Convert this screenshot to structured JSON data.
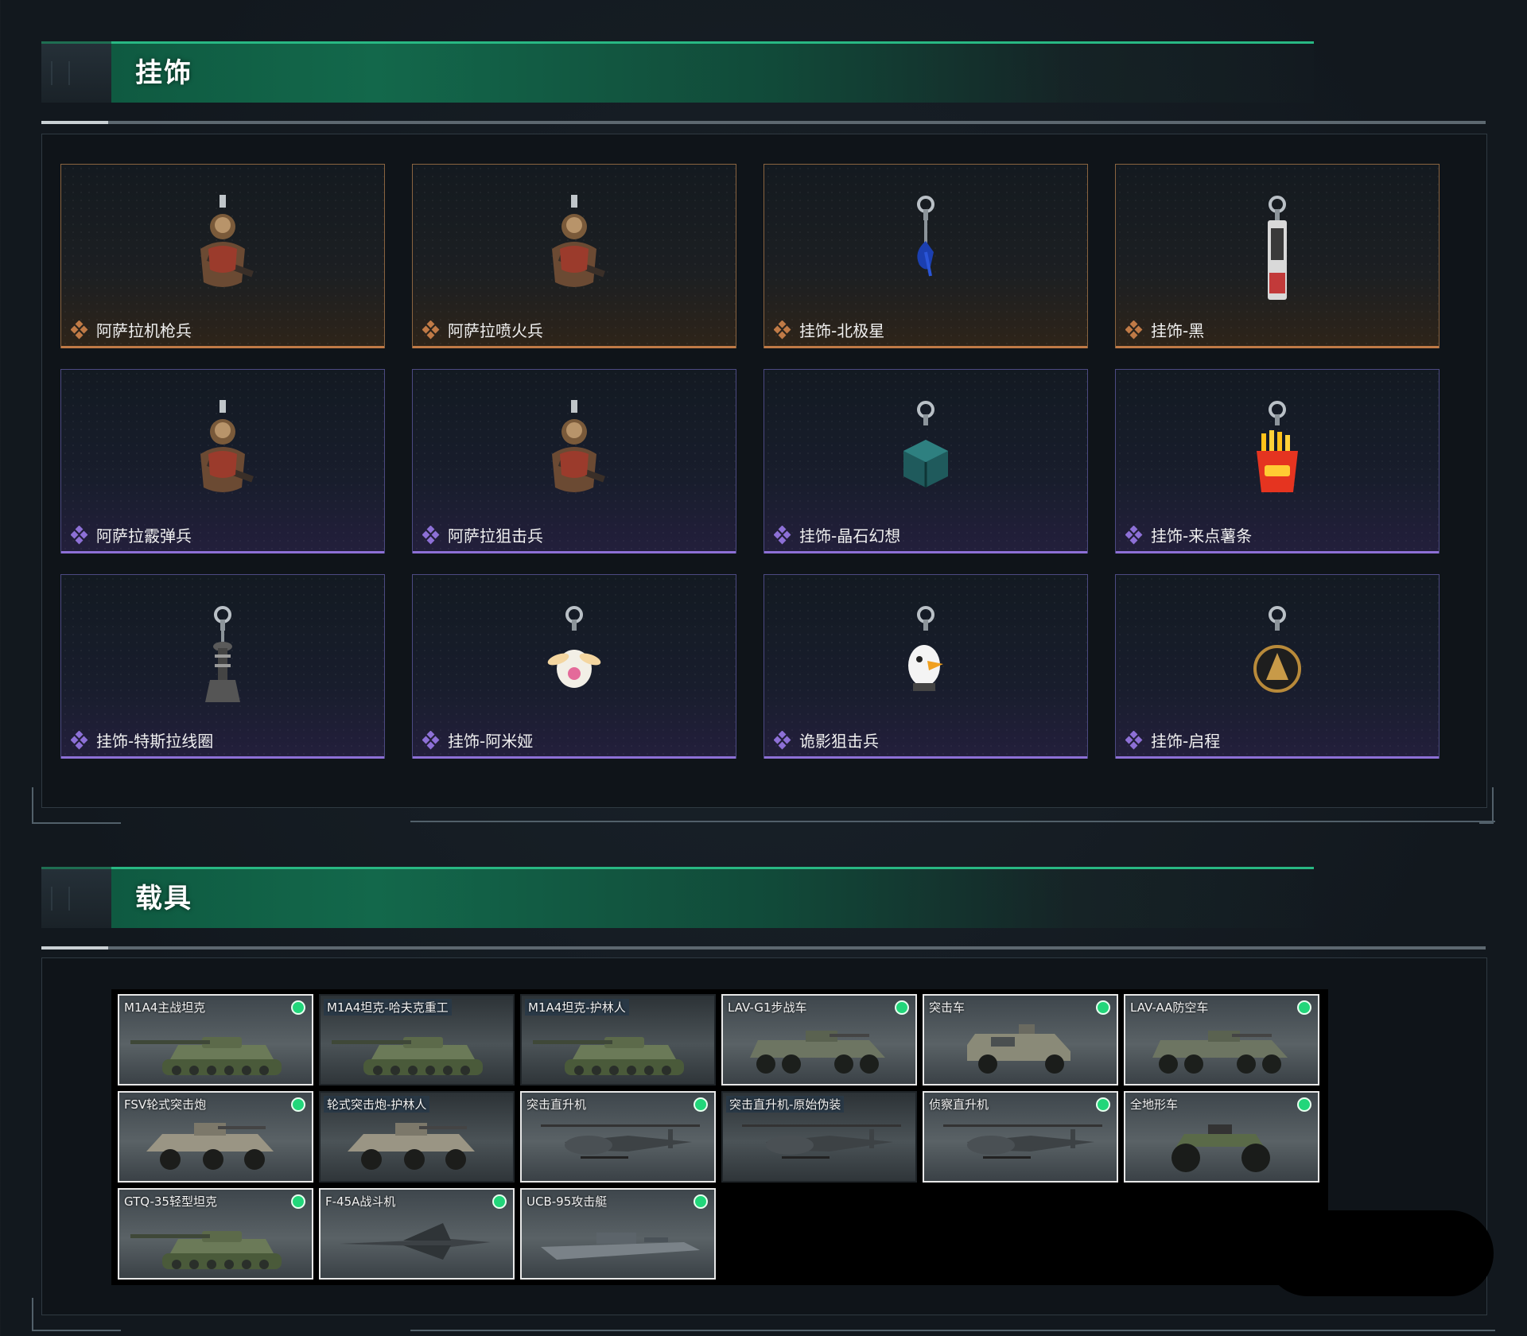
{
  "sections": {
    "charms": {
      "title": "挂饰",
      "items": [
        {
          "name": "阿萨拉机枪兵",
          "rarity": "gold",
          "icon": "operator-figure-icon"
        },
        {
          "name": "阿萨拉喷火兵",
          "rarity": "gold",
          "icon": "operator-figure-icon"
        },
        {
          "name": "挂饰-北极星",
          "rarity": "gold",
          "icon": "star-charm-icon"
        },
        {
          "name": "挂饰-黑",
          "rarity": "gold",
          "icon": "tag-charm-icon"
        },
        {
          "name": "阿萨拉霰弹兵",
          "rarity": "purple",
          "icon": "operator-figure-icon"
        },
        {
          "name": "阿萨拉狙击兵",
          "rarity": "purple",
          "icon": "operator-figure-icon"
        },
        {
          "name": "挂饰-晶石幻想",
          "rarity": "purple",
          "icon": "cube-charm-icon"
        },
        {
          "name": "挂饰-来点薯条",
          "rarity": "purple",
          "icon": "fries-charm-icon"
        },
        {
          "name": "挂饰-特斯拉线圈",
          "rarity": "purple",
          "icon": "tesla-coil-charm-icon"
        },
        {
          "name": "挂饰-阿米娅",
          "rarity": "purple",
          "icon": "bunny-charm-icon"
        },
        {
          "name": "诡影狙击兵",
          "rarity": "purple",
          "icon": "duck-charm-icon"
        },
        {
          "name": "挂饰-启程",
          "rarity": "purple",
          "icon": "medal-charm-icon"
        }
      ]
    },
    "vehicles": {
      "title": "载具",
      "items": [
        {
          "name": "M1A4主战坦克",
          "owned": true,
          "highlight": true,
          "kind": "tank"
        },
        {
          "name": "M1A4坦克-哈夫克重工",
          "owned": false,
          "highlight": false,
          "kind": "tank"
        },
        {
          "name": "M1A4坦克-护林人",
          "owned": false,
          "highlight": false,
          "kind": "tank"
        },
        {
          "name": "LAV-G1步战车",
          "owned": true,
          "highlight": true,
          "kind": "apc"
        },
        {
          "name": "突击车",
          "owned": true,
          "highlight": true,
          "kind": "truck"
        },
        {
          "name": "LAV-AA防空车",
          "owned": true,
          "highlight": true,
          "kind": "apc"
        },
        {
          "name": "FSV轮式突击炮",
          "owned": true,
          "highlight": true,
          "kind": "armored-car"
        },
        {
          "name": "轮式突击炮-护林人",
          "owned": false,
          "highlight": false,
          "kind": "armored-car"
        },
        {
          "name": "突击直升机",
          "owned": true,
          "highlight": true,
          "kind": "helicopter"
        },
        {
          "name": "突击直升机-原始伪装",
          "owned": false,
          "highlight": false,
          "kind": "helicopter"
        },
        {
          "name": "侦察直升机",
          "owned": true,
          "highlight": true,
          "kind": "helicopter"
        },
        {
          "name": "全地形车",
          "owned": true,
          "highlight": true,
          "kind": "atv"
        },
        {
          "name": "GTQ-35轻型坦克",
          "owned": true,
          "highlight": true,
          "kind": "tank"
        },
        {
          "name": "F-45A战斗机",
          "owned": true,
          "highlight": true,
          "kind": "jet"
        },
        {
          "name": "UCB-95攻击艇",
          "owned": true,
          "highlight": true,
          "kind": "boat"
        }
      ]
    }
  },
  "colors": {
    "accent_green": "#28b883",
    "gold_rarity": "#c07a46",
    "purple_rarity": "#8d70d6",
    "owned_dot": "#22d67a"
  }
}
